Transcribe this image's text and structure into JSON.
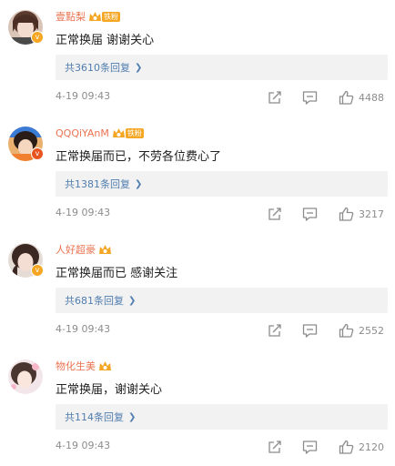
{
  "comments": [
    {
      "username": "壹點梨",
      "badge": "铁粉",
      "text": "正常换届 谢谢关心",
      "replies": "共3610条回复",
      "time": "4-19 09:43",
      "likes": "4488",
      "verify_color": "#f5a623"
    },
    {
      "username": "QQQiYAnM",
      "badge": "铁粉",
      "text": "正常换届而已，不劳各位费心了",
      "replies": "共1381条回复",
      "time": "4-19 09:43",
      "likes": "3217",
      "verify_color": "#e8541e"
    },
    {
      "username": "人好超豪",
      "badge": "",
      "text": "正常换届而已 感谢关注",
      "replies": "共681条回复",
      "time": "4-19 09:43",
      "likes": "2552",
      "verify_color": "#f5a623"
    },
    {
      "username": "物化生美",
      "badge": "",
      "text": "正常换届，谢谢关心",
      "replies": "共114条回复",
      "time": "4-19 09:43",
      "likes": "2120",
      "verify_color": ""
    }
  ],
  "icons": {
    "share": "share-icon",
    "reply": "comment-icon",
    "like": "thumbs-up-icon",
    "chevron": "chevron-right-icon",
    "crown": "crown-icon"
  },
  "colors": {
    "username": "#eb7350",
    "link": "#507daf",
    "meta": "#8c8c8c",
    "reply_bg": "#f2f2f2"
  }
}
